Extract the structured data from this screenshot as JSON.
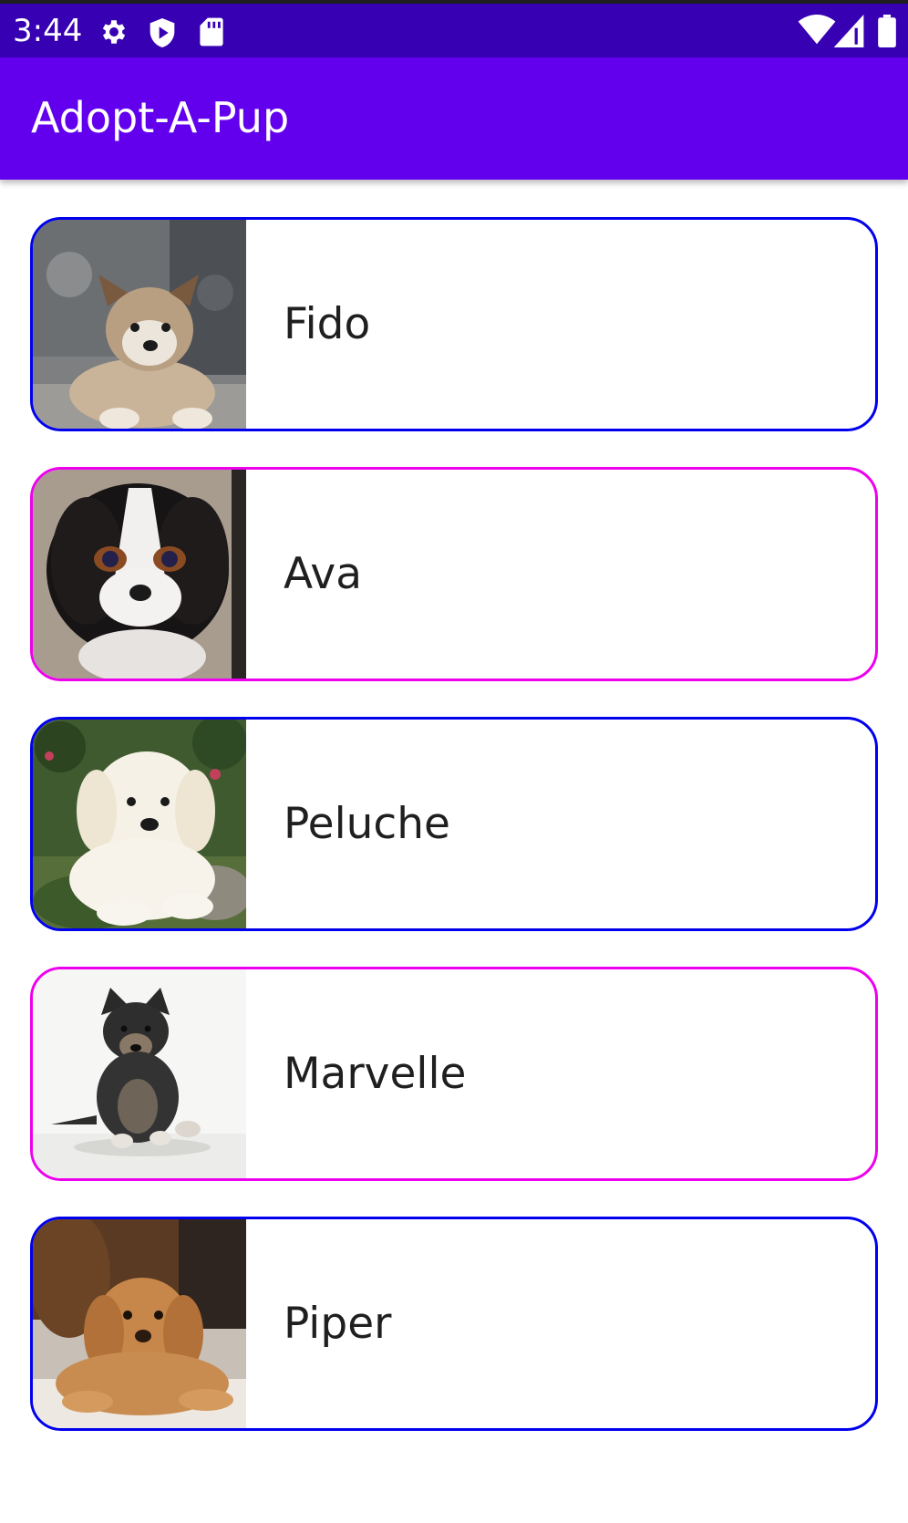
{
  "status_bar": {
    "time": "3:44",
    "left_icons": [
      "gear-icon",
      "shield-play-icon",
      "sd-card-icon"
    ],
    "right_icons": [
      "wifi-icon",
      "signal-icon",
      "battery-icon"
    ]
  },
  "app_bar": {
    "title": "Adopt-A-Pup",
    "background": "#6200ee"
  },
  "colors": {
    "status_bar": "#3700b3",
    "card_border_blue": "#0000ee",
    "card_border_magenta": "#ee00ee",
    "text": "#1f1f1f"
  },
  "puppies": [
    {
      "name": "Fido",
      "border": "blue",
      "image": "puppy-photo-fido"
    },
    {
      "name": "Ava",
      "border": "magenta",
      "image": "puppy-photo-ava"
    },
    {
      "name": "Peluche",
      "border": "blue",
      "image": "puppy-photo-peluche"
    },
    {
      "name": "Marvelle",
      "border": "magenta",
      "image": "puppy-photo-marvelle"
    },
    {
      "name": "Piper",
      "border": "blue",
      "image": "puppy-photo-piper"
    }
  ]
}
